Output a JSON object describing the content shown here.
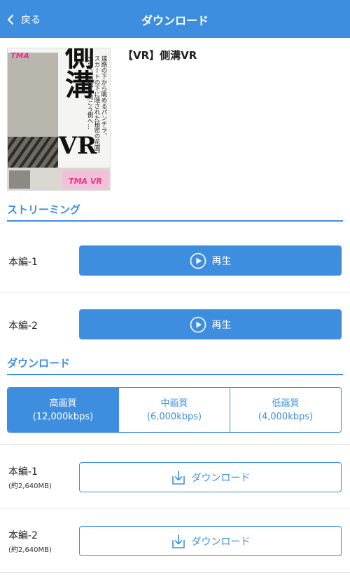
{
  "nav": {
    "back_label": "戻る",
    "title": "ダウンロード"
  },
  "product": {
    "title": "【VR】側溝VR",
    "cover": {
      "brand": "TMA",
      "main_text": "側溝VR",
      "tagline": "道路の下から眺めるパンチラ、スカートの下に隠された秘密の花園。VRで、側溝の向こう側へ…",
      "badge": "TMA VR"
    }
  },
  "streaming": {
    "heading": "ストリーミング",
    "items": [
      {
        "label": "本編-1",
        "button": "再生"
      },
      {
        "label": "本編-2",
        "button": "再生"
      }
    ]
  },
  "download": {
    "heading": "ダウンロード",
    "qualities": [
      {
        "name": "高画質",
        "rate": "(12,000kbps)",
        "selected": true
      },
      {
        "name": "中画質",
        "rate": "(6,000kbps)",
        "selected": false
      },
      {
        "name": "低画質",
        "rate": "(4,000kbps)",
        "selected": false
      }
    ],
    "items": [
      {
        "label": "本編-1",
        "size": "(約2,640MB)",
        "button": "ダウンロード"
      },
      {
        "label": "本編-2",
        "size": "(約2,640MB)",
        "button": "ダウンロード"
      }
    ]
  },
  "colors": {
    "accent": "#3e8ee0",
    "divider": "#e2e2e2"
  },
  "icons": {
    "back": "chevron-left-icon",
    "play": "play-circle-icon",
    "download": "download-icon"
  }
}
